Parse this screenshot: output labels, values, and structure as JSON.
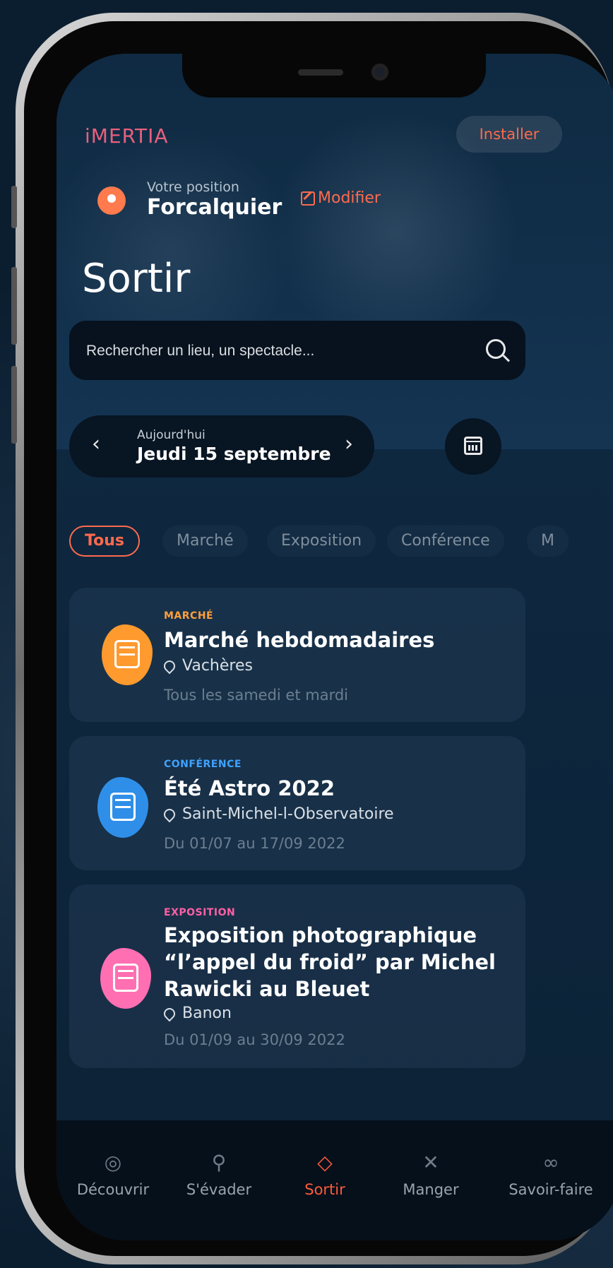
{
  "header": {
    "logo": "iMERTIA",
    "install_label": "Installer"
  },
  "location": {
    "label": "Votre position",
    "city": "Forcalquier",
    "modify_label": "Modifier"
  },
  "page_title": "Sortir",
  "search": {
    "placeholder": "Rechercher un lieu, un spectacle..."
  },
  "date_picker": {
    "small": "Aujourd'hui",
    "main": "Jeudi 15 septembre",
    "prev": "‹",
    "next": "›"
  },
  "filters": [
    "Tous",
    "Marché",
    "Exposition",
    "Conférence",
    "M"
  ],
  "events": [
    {
      "category": "MARCHÉ",
      "category_color": "#ff9f3c",
      "title": "Marché hebdomadaires",
      "place": "Vachères",
      "dates": "Tous les samedi et mardi",
      "blob_color": "#ff9a2e"
    },
    {
      "category": "CONFÉRENCE",
      "category_color": "#3fa2ff",
      "title": "Été Astro 2022",
      "place": "Saint-Michel-l-Observatoire",
      "dates": "Du 01/07 au 17/09 2022",
      "blob_color": "#2f8fe8"
    },
    {
      "category": "EXPOSITION",
      "category_color": "#ff5fa5",
      "title_lines": [
        "Exposition photographique",
        "“l’appel du froid” par Michel",
        "Rawicki au Bleuet"
      ],
      "place": "Banon",
      "dates": "Du 01/09 au 30/09 2022",
      "blob_color": "#ff6fb2"
    }
  ],
  "tabs": [
    {
      "label": "Découvrir",
      "icon": "compass-icon"
    },
    {
      "label": "S'évader",
      "icon": "hiker-icon"
    },
    {
      "label": "Sortir",
      "icon": "ticket-icon"
    },
    {
      "label": "Manger",
      "icon": "cutlery-icon"
    },
    {
      "label": "Savoir-faire",
      "icon": "handshake-icon"
    }
  ],
  "colors": {
    "accent": "#ff6a4d",
    "background": "#0e2840"
  }
}
